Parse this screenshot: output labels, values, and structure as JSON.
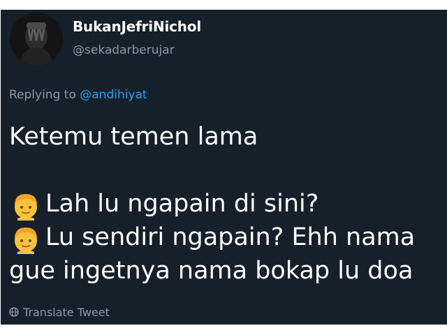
{
  "tweet": {
    "author": {
      "display_name": "BukanJefriNichol",
      "handle": "@sekadarberujar",
      "avatar_icon": "avatar-icon"
    },
    "reply_context": {
      "prefix": "Replying to",
      "mention": "@andihiyat"
    },
    "lines": [
      "Ketemu temen lama",
      "",
      "Lah lu ngapain di sini?",
      "Lu sendiri ngapain? Ehh nama",
      "gue ingetnya nama bokap lu doa"
    ],
    "emoji_lines": [
      {
        "line": 2,
        "emoji": "blond-person-emoji"
      },
      {
        "line": 3,
        "emoji": "blond-person-emoji"
      }
    ],
    "translate_label": "Translate Tweet",
    "colors": {
      "background": "#15202b",
      "primary_text": "#ffffff",
      "secondary_text": "#8899a6",
      "link": "#1da1f2",
      "emoji_face": "#f7c23c",
      "emoji_hair": "#f4a522"
    }
  }
}
